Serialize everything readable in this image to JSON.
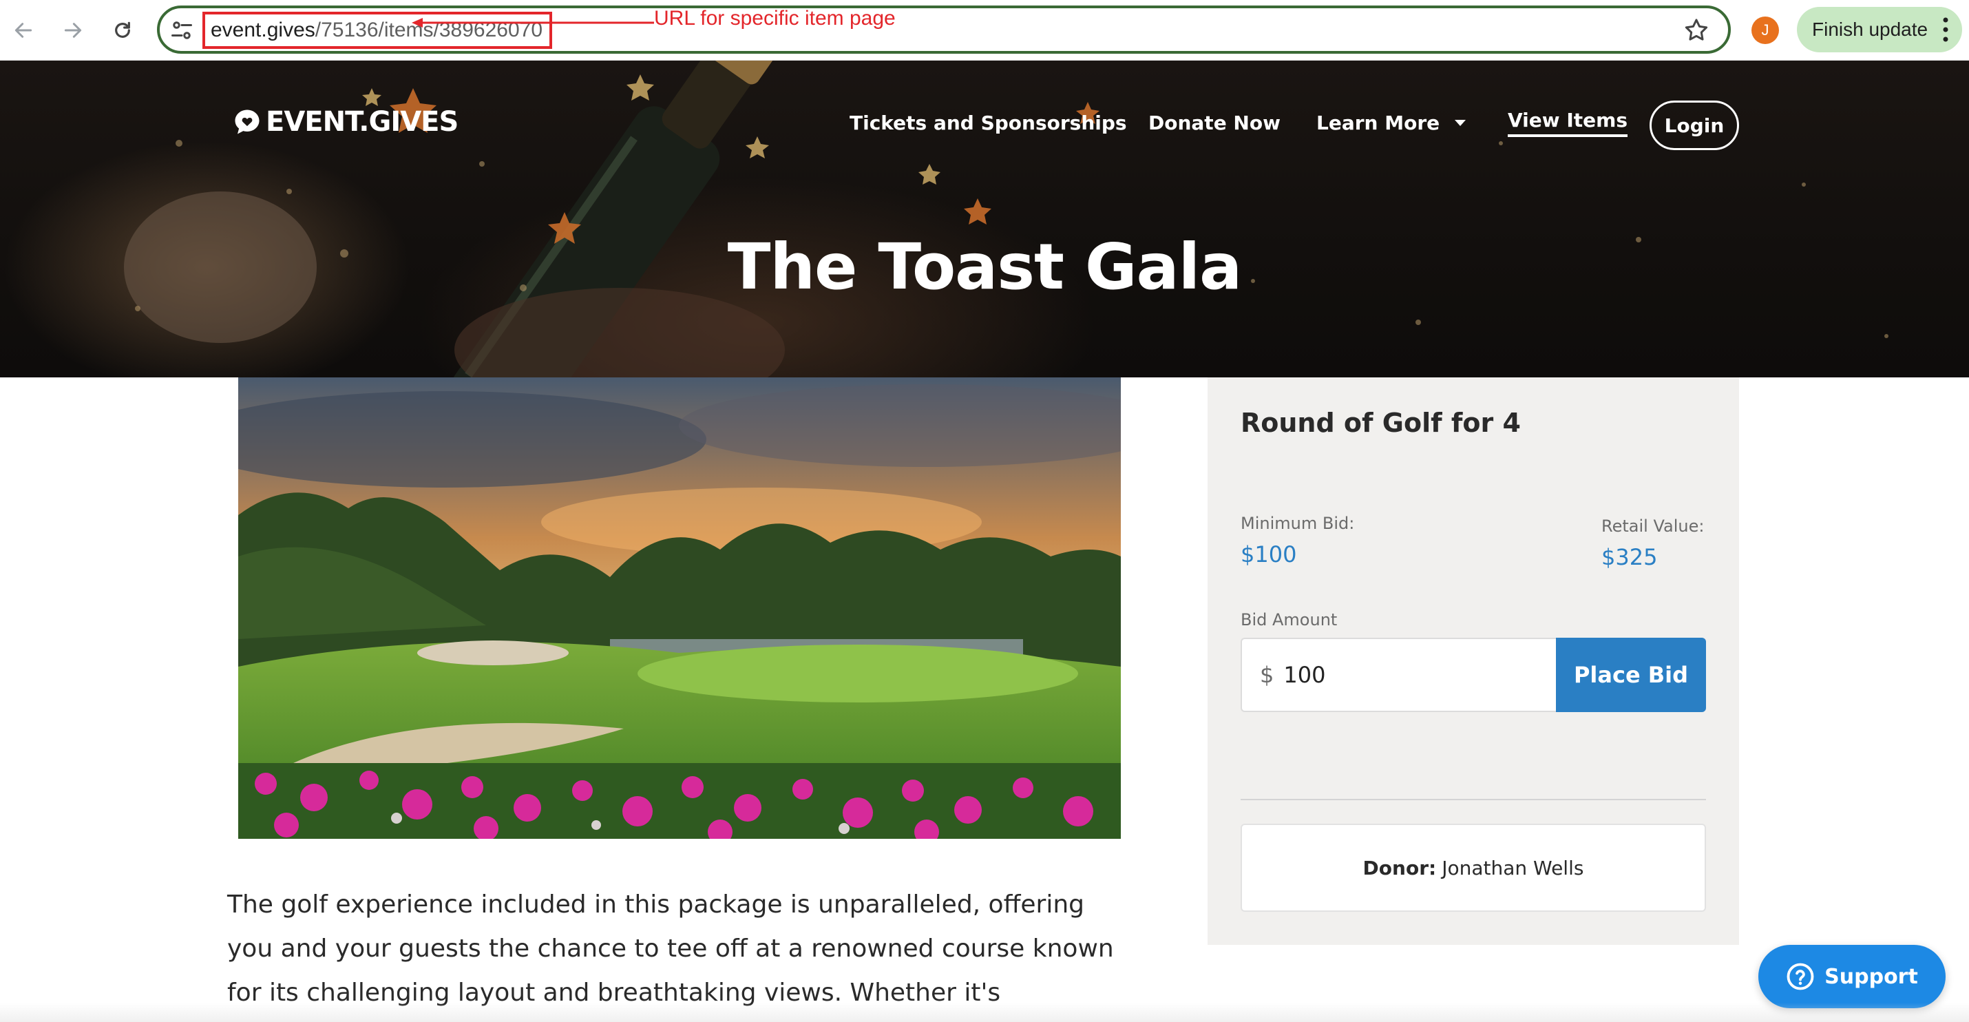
{
  "browser": {
    "url_host": "event.gives",
    "url_path": "/75136/items/389626070",
    "annotation": "URL for specific item page",
    "profile_initial": "J",
    "finish_update_label": "Finish update",
    "icons": {
      "back": "back-arrow-icon",
      "forward": "forward-arrow-icon",
      "reload": "reload-icon",
      "site_settings": "tune-icon",
      "bookmark": "star-icon",
      "menu": "kebab-menu-icon"
    }
  },
  "header": {
    "brand": "EVENT.GIVES",
    "nav": [
      {
        "label": "Tickets and Sponsorships"
      },
      {
        "label": "Donate Now"
      },
      {
        "label": "Learn More"
      },
      {
        "label": "View Items"
      }
    ],
    "login_label": "Login",
    "event_title": "The Toast Gala"
  },
  "item": {
    "title": "Round of Golf for 4",
    "min_bid_label": "Minimum Bid:",
    "min_bid_value": "$100",
    "retail_label": "Retail Value:",
    "retail_value": "$325",
    "bid_amount_label": "Bid Amount",
    "currency_symbol": "$",
    "bid_amount_value": "100",
    "place_bid_label": "Place Bid",
    "donor_label": "Donor:",
    "donor_name": "Jonathan Wells",
    "description": "The golf experience included in this package is unparalleled, offering you and your guests the chance to tee off at a renowned course known for its challenging layout and breathtaking views. Whether it's"
  },
  "support": {
    "label": "Support"
  },
  "colors": {
    "accent": "#2a7fc4",
    "annotation_red": "#e3262b",
    "support_blue": "#1d89e4",
    "panel_bg": "#f1f0ee"
  }
}
